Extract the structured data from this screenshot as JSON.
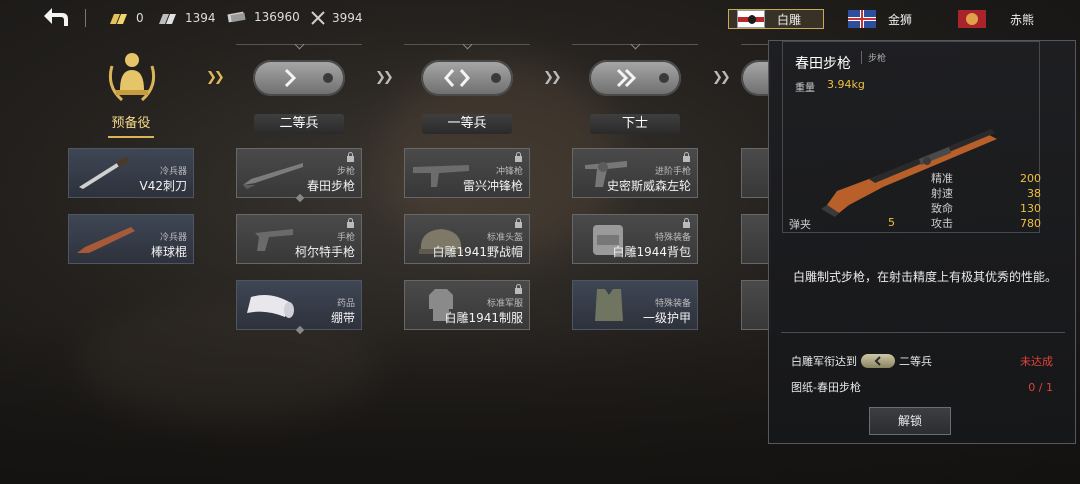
{
  "topbar": {
    "currencies": [
      {
        "icon": "gold-bars-icon",
        "value": "0"
      },
      {
        "icon": "silver-bars-icon",
        "value": "1394"
      },
      {
        "icon": "banknotes-icon",
        "value": "136960"
      },
      {
        "icon": "crossed-swords-icon",
        "value": "3994"
      }
    ],
    "factions": [
      {
        "name": "白雕",
        "active": true,
        "flag_color": "#b8272c"
      },
      {
        "name": "金狮",
        "active": false,
        "flag_color": "#2b4f9c"
      },
      {
        "name": "赤熊",
        "active": false,
        "flag_color": "#b8272c"
      }
    ]
  },
  "ranks": [
    {
      "label": "预备役",
      "current": true
    },
    {
      "label": "二等兵",
      "current": false
    },
    {
      "label": "一等兵",
      "current": false
    },
    {
      "label": "下士",
      "current": false
    }
  ],
  "items": [
    [
      {
        "category": "冷兵器",
        "name": "V42刺刀",
        "locked": false,
        "icon": "bayonet-icon"
      },
      {
        "category": "冷兵器",
        "name": "棒球棍",
        "locked": false,
        "icon": "baseball-bat-icon"
      },
      {
        "category": "药品",
        "name": "绷带",
        "locked": false,
        "icon": "bandage-icon"
      }
    ],
    [
      {
        "category": "步枪",
        "name": "春田步枪",
        "locked": true,
        "icon": "rifle-icon"
      },
      {
        "category": "手枪",
        "name": "柯尔特手枪",
        "locked": true,
        "icon": "pistol-icon"
      }
    ],
    [
      {
        "category": "冲锋枪",
        "name": "雷兴冲锋枪",
        "locked": true,
        "icon": "submachine-gun-icon"
      },
      {
        "category": "标准头盔",
        "name": "白雕1941野战帽",
        "locked": true,
        "icon": "field-cap-icon"
      },
      {
        "category": "标准军服",
        "name": "白雕1941制服",
        "locked": true,
        "icon": "uniform-icon"
      }
    ],
    [
      {
        "category": "进阶手枪",
        "name": "史密斯威森左轮",
        "locked": true,
        "icon": "revolver-icon"
      },
      {
        "category": "特殊装备",
        "name": "白雕1944背包",
        "locked": true,
        "icon": "backpack-icon"
      },
      {
        "category": "特殊装备",
        "name": "一级护甲",
        "locked": false,
        "icon": "vest-icon"
      }
    ]
  ],
  "detail": {
    "title": "春田步枪",
    "type": "步枪",
    "weight_label": "重量",
    "weight_value": "3.94kg",
    "stats": [
      {
        "label": "精准",
        "value": "200"
      },
      {
        "label": "射速",
        "value": "38"
      },
      {
        "label": "致命",
        "value": "130"
      },
      {
        "label": "攻击",
        "value": "780"
      }
    ],
    "ammo_label": "弹夹",
    "ammo_value": "5",
    "description": "白雕制式步枪，在射击精度上有极其优秀的性能。",
    "requirements": [
      {
        "prefix": "白雕军衔达到",
        "rank": "二等兵",
        "status": "未达成"
      },
      {
        "prefix": "图纸-春田步枪",
        "rank": "",
        "status": "0 / 1"
      }
    ],
    "unlock_label": "解锁"
  }
}
